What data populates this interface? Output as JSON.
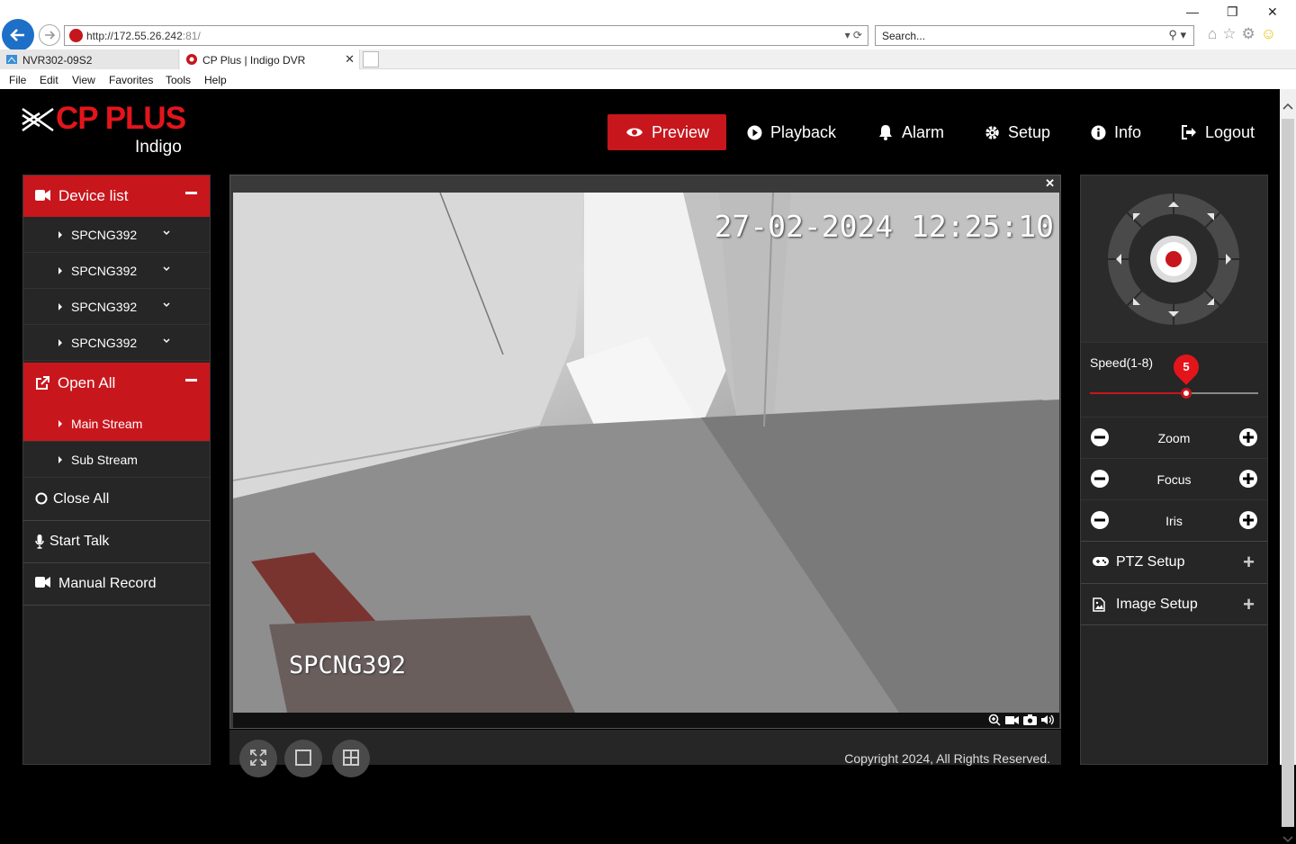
{
  "browser": {
    "url_host": "http://172.55.26.242",
    "url_port": ":81/",
    "search_placeholder": "Search...",
    "tabs": [
      {
        "label": "NVR302-09S2"
      },
      {
        "label": "CP Plus | Indigo DVR"
      }
    ],
    "menu": [
      "File",
      "Edit",
      "View",
      "Favorites",
      "Tools",
      "Help"
    ]
  },
  "brand": {
    "name": "CP PLUS",
    "sub": "Indigo",
    "color": "#e3151b"
  },
  "nav": [
    {
      "label": "Preview",
      "icon": "eye-icon",
      "active": true
    },
    {
      "label": "Playback",
      "icon": "play-circle-icon"
    },
    {
      "label": "Alarm",
      "icon": "bell-icon"
    },
    {
      "label": "Setup",
      "icon": "gear-icon"
    },
    {
      "label": "Info",
      "icon": "info-icon"
    },
    {
      "label": "Logout",
      "icon": "logout-icon"
    }
  ],
  "sidebar": {
    "device_list_label": "Device list",
    "devices": [
      {
        "label": "SPCNG392"
      },
      {
        "label": "SPCNG392"
      },
      {
        "label": "SPCNG392"
      },
      {
        "label": "SPCNG392"
      }
    ],
    "open_all_label": "Open All",
    "streams": [
      {
        "label": "Main Stream",
        "active": true
      },
      {
        "label": "Sub Stream",
        "active": false
      }
    ],
    "close_all_label": "Close All",
    "start_talk_label": "Start Talk",
    "manual_record_label": "Manual Record"
  },
  "video": {
    "timestamp": "27-02-2024 12:25:10",
    "camera_name": "SPCNG392"
  },
  "footer": {
    "copyright": "Copyright 2024, All Rights Reserved."
  },
  "ptz": {
    "speed_label": "Speed(1-8)",
    "speed_value": "5",
    "speed_min": 1,
    "speed_max": 8,
    "zoom_label": "Zoom",
    "focus_label": "Focus",
    "iris_label": "Iris",
    "ptz_setup_label": "PTZ Setup",
    "image_setup_label": "Image Setup"
  },
  "colors": {
    "accent": "#c8161d",
    "panel": "#262626"
  }
}
